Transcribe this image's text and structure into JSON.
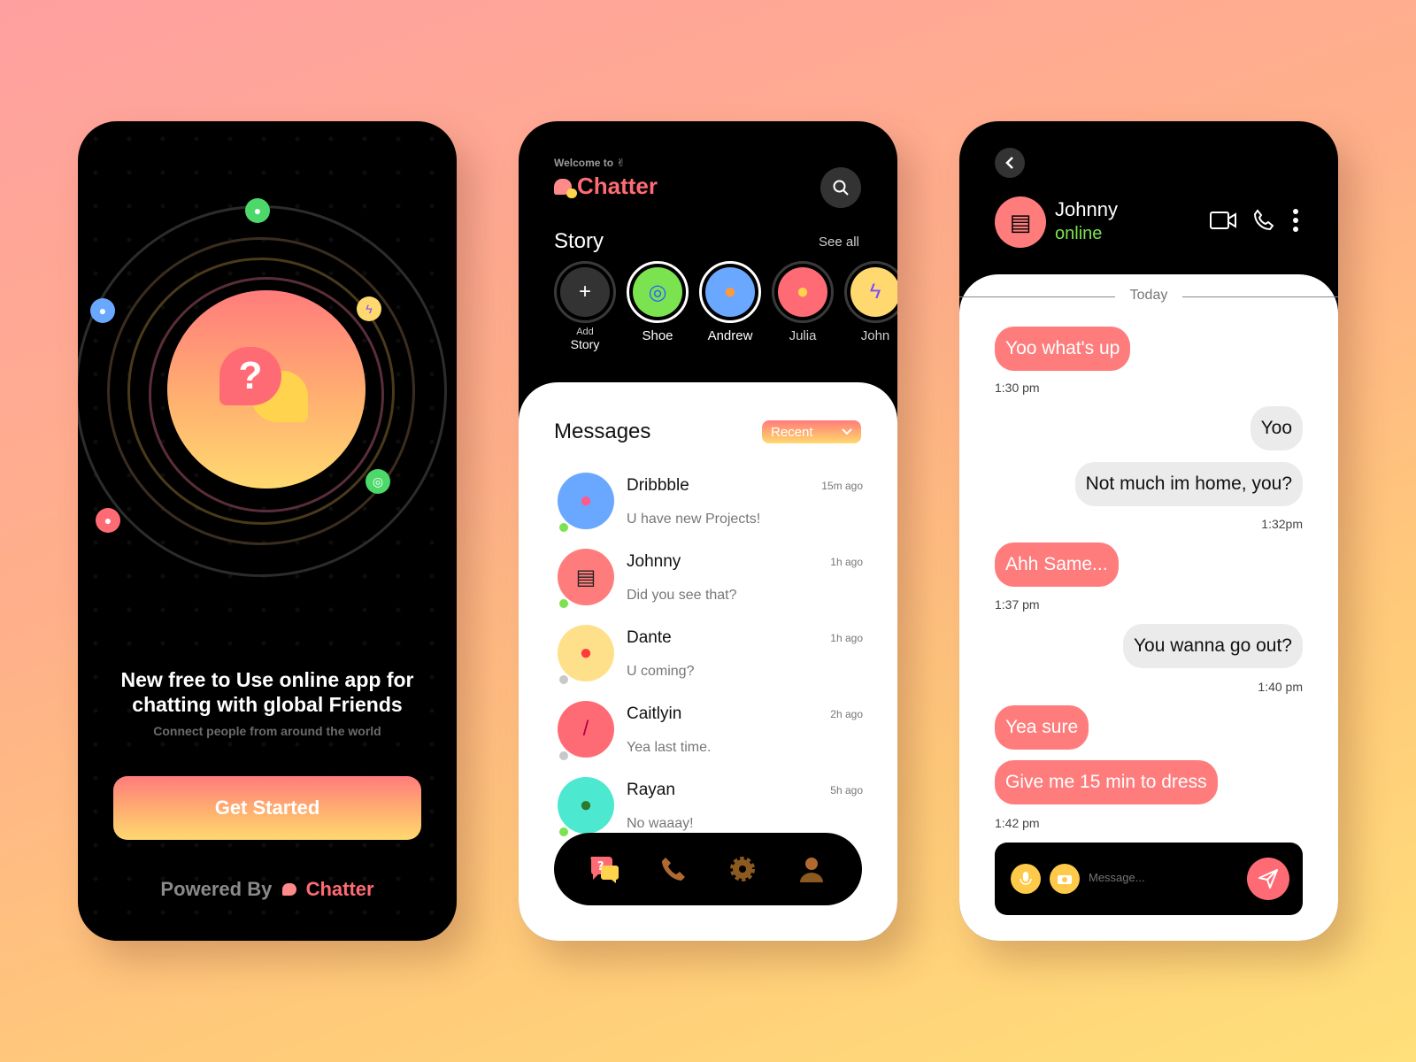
{
  "colors": {
    "accent": "#ff6b74",
    "online": "#7be34f",
    "gradient_top": "#ff7c7c",
    "gradient_bottom": "#ffd970"
  },
  "onboarding": {
    "headline": "New free to Use online app for chatting with global Friends",
    "subtitle": "Connect people from around the world",
    "cta_label": "Get Started",
    "powered_by": "Powered By",
    "brand": "Chatter"
  },
  "home": {
    "welcome": "Welcome to ✌",
    "brand": "Chatter",
    "story_title": "Story",
    "see_all": "See all",
    "stories": [
      {
        "label_top": "Add",
        "label": "Story",
        "icon": "plus-icon"
      },
      {
        "label": "Shoe",
        "icon": "target-icon",
        "color": "#7be34f"
      },
      {
        "label": "Andrew",
        "icon": "person-icon",
        "color": "#6aa8ff"
      },
      {
        "label": "Julia",
        "icon": "face-icon",
        "color": "#ff6b74"
      },
      {
        "label": "John",
        "icon": "lightning-icon",
        "color": "#ffd970"
      }
    ],
    "messages_title": "Messages",
    "filter_label": "Recent",
    "messages": [
      {
        "name": "Dribbble",
        "time": "15m ago",
        "preview": "U have new Projects!",
        "icon": "basketball-icon",
        "online": true,
        "color": "#6aa8ff"
      },
      {
        "name": "Johnny",
        "time": "1h ago",
        "preview": "Did you see that?",
        "icon": "clapper-icon",
        "online": true,
        "color": "#ff7c7c"
      },
      {
        "name": "Dante",
        "time": "1h ago",
        "preview": "U coming?",
        "icon": "boxing-glove-icon",
        "online": false,
        "color": "#ffe08a"
      },
      {
        "name": "Caitlyin",
        "time": "2h ago",
        "preview": "Yea last time.",
        "icon": "lipstick-icon",
        "online": false,
        "color": "#ff6b74"
      },
      {
        "name": "Rayan",
        "time": "5h ago",
        "preview": "No waaay!",
        "icon": "alien-icon",
        "online": true,
        "color": "#4de8d0"
      }
    ],
    "nav": [
      "chat-icon",
      "phone-icon",
      "gear-icon",
      "profile-icon"
    ]
  },
  "chat": {
    "contact_name": "Johnny",
    "contact_status": "online",
    "day_divider": "Today",
    "messages": [
      {
        "dir": "in",
        "text": "Yoo what's up"
      },
      {
        "time": "1:30 pm"
      },
      {
        "dir": "out",
        "text": "Yoo"
      },
      {
        "dir": "out",
        "text": "Not much im home, you?"
      },
      {
        "time": "1:32pm"
      },
      {
        "dir": "in",
        "text": "Ahh Same..."
      },
      {
        "time": "1:37 pm"
      },
      {
        "dir": "out",
        "text": "You wanna go out?"
      },
      {
        "time": "1:40 pm"
      },
      {
        "dir": "in",
        "text": "Yea sure"
      },
      {
        "dir": "in",
        "text": "Give me 15 min to dress"
      },
      {
        "time": "1:42 pm"
      }
    ],
    "composer_placeholder": "Message..."
  }
}
